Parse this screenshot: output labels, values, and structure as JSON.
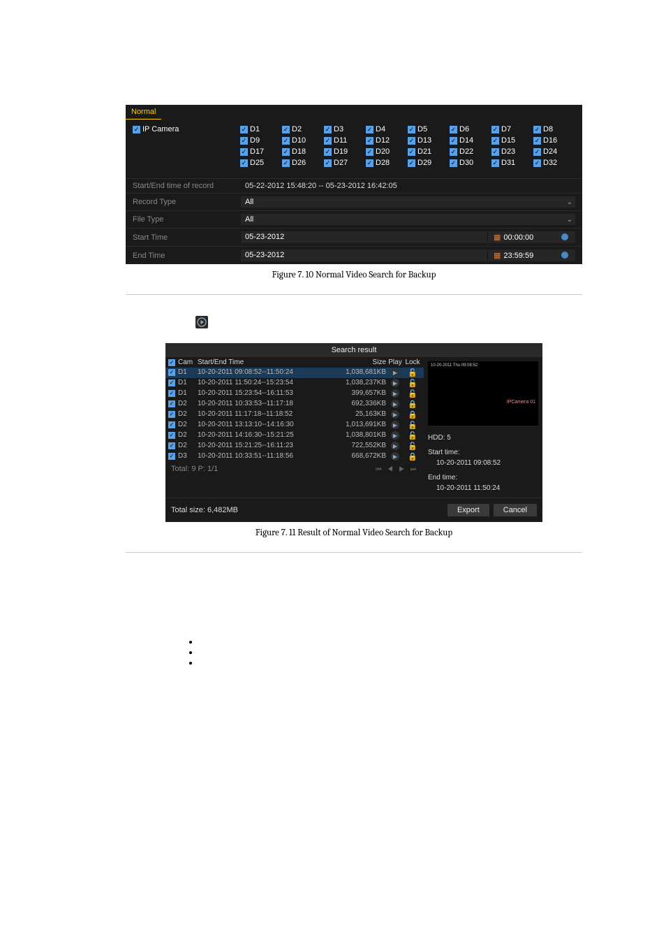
{
  "figure7_10": {
    "tab": "Normal",
    "ip_camera_label": "IP Camera",
    "cameras": [
      "D1",
      "D2",
      "D3",
      "D4",
      "D5",
      "D6",
      "D7",
      "D8",
      "D9",
      "D10",
      "D11",
      "D12",
      "D13",
      "D14",
      "D15",
      "D16",
      "D17",
      "D18",
      "D19",
      "D20",
      "D21",
      "D22",
      "D23",
      "D24",
      "D25",
      "D26",
      "D27",
      "D28",
      "D29",
      "D30",
      "D31",
      "D32"
    ],
    "rows": {
      "record_time_label": "Start/End time of record",
      "record_time_value": "05-22-2012 15:48:20  --  05-23-2012 16:42:05",
      "record_type_label": "Record Type",
      "record_type_value": "All",
      "file_type_label": "File Type",
      "file_type_value": "All",
      "start_time_label": "Start Time",
      "start_date": "05-23-2012",
      "start_clock": "00:00:00",
      "end_time_label": "End Time",
      "end_date": "05-23-2012",
      "end_clock": "23:59:59"
    },
    "caption": "Figure 7. 10 Normal Video Search for Backup"
  },
  "figure7_11": {
    "title": "Search result",
    "headers": {
      "cam": "Cam",
      "time": "Start/End Time",
      "size": "Size",
      "play": "Play",
      "lock": "Lock"
    },
    "rows": [
      {
        "cam": "D1",
        "time": "10-20-2011 09:08:52--11:50:24",
        "size": "1,038,681KB",
        "locked": false,
        "sel": true
      },
      {
        "cam": "D1",
        "time": "10-20-2011 11:50:24--15:23:54",
        "size": "1,038,237KB",
        "locked": false,
        "sel": false
      },
      {
        "cam": "D1",
        "time": "10-20-2011 15:23:54--16:11:53",
        "size": "399,657KB",
        "locked": false,
        "sel": false
      },
      {
        "cam": "D2",
        "time": "10-20-2011 10:33:53--11:17:18",
        "size": "692,336KB",
        "locked": true,
        "sel": false
      },
      {
        "cam": "D2",
        "time": "10-20-2011 11:17:18--11:18:52",
        "size": "25,163KB",
        "locked": true,
        "sel": false
      },
      {
        "cam": "D2",
        "time": "10-20-2011 13:13:10--14:16:30",
        "size": "1,013,691KB",
        "locked": false,
        "sel": false
      },
      {
        "cam": "D2",
        "time": "10-20-2011 14:16:30--15:21:25",
        "size": "1,038,801KB",
        "locked": false,
        "sel": false
      },
      {
        "cam": "D2",
        "time": "10-20-2011 15:21:25--16:11:23",
        "size": "722,552KB",
        "locked": false,
        "sel": false
      },
      {
        "cam": "D3",
        "time": "10-20-2011 10:33:51--11:18:56",
        "size": "668,672KB",
        "locked": true,
        "sel": false
      }
    ],
    "preview": {
      "ts": "10-20-2011 Thu 09:08:52",
      "tag": "IPCamera 01"
    },
    "info": {
      "hdd": "HDD: 5",
      "start_label": "Start time:",
      "start_val": "10-20-2011 09:08:52",
      "end_label": "End time:",
      "end_val": "10-20-2011 11:50:24"
    },
    "pager": "Total: 9  P: 1/1",
    "total_size": "Total size: 6,482MB",
    "buttons": {
      "export": "Export",
      "cancel": "Cancel"
    },
    "caption": "Figure 7. 11 Result of Normal Video Search for Backup"
  }
}
